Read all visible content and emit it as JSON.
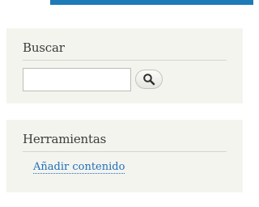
{
  "search_block": {
    "title": "Buscar",
    "input_value": "",
    "input_placeholder": "",
    "button_icon": "search-icon"
  },
  "tools_block": {
    "title": "Herramientas",
    "links": [
      {
        "label": "Añadir contenido"
      }
    ]
  },
  "colors": {
    "accent": "#1f7ab8",
    "block_bg": "#f4f4ef",
    "link": "#1f6fb8"
  }
}
